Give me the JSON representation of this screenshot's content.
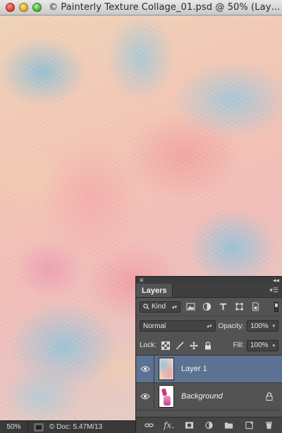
{
  "window": {
    "title": "© Painterly Texture Collage_01.psd @ 50% (Lay…"
  },
  "status_bar": {
    "zoom": "50%",
    "doc_info": "© Doc: 5.47M/13"
  },
  "layers_panel": {
    "tab_label": "Layers",
    "filter": {
      "kind_label": "Kind",
      "icons": [
        "image-filter-icon",
        "adjustment-filter-icon",
        "type-filter-icon",
        "shape-filter-icon",
        "smart-object-filter-icon"
      ]
    },
    "blend_mode": "Normal",
    "opacity_label": "Opacity:",
    "opacity_value": "100%",
    "lock_label": "Lock:",
    "fill_label": "Fill:",
    "fill_value": "100%",
    "layers": [
      {
        "name": "Layer 1",
        "selected": true,
        "visible": true
      },
      {
        "name": "Background",
        "selected": false,
        "visible": true,
        "locked": true
      }
    ]
  },
  "colors": {
    "panel_bg": "#535353",
    "selected_layer": "#5c7292",
    "statusbar_bg": "#393939"
  }
}
